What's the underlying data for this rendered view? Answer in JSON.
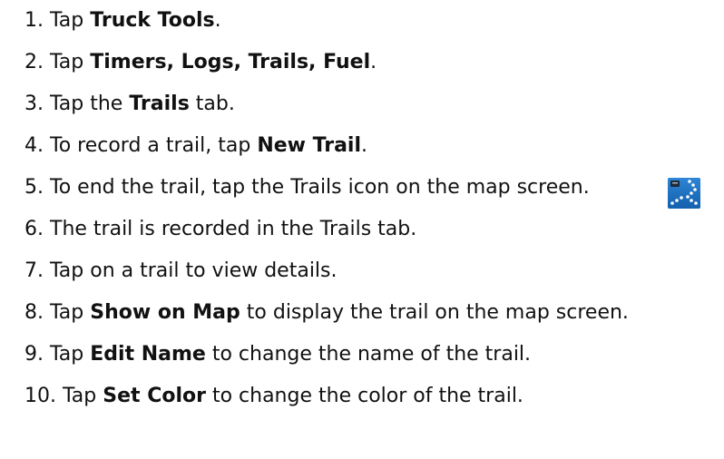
{
  "steps": [
    {
      "num": "1.",
      "parts": [
        {
          "t": "Tap ",
          "b": false
        },
        {
          "t": "Truck Tools",
          "b": true
        },
        {
          "t": ".",
          "b": false
        }
      ]
    },
    {
      "num": "2.",
      "parts": [
        {
          "t": "Tap ",
          "b": false
        },
        {
          "t": "Timers, Logs, Trails, Fuel",
          "b": true
        },
        {
          "t": ".",
          "b": false
        }
      ]
    },
    {
      "num": "3.",
      "parts": [
        {
          "t": "Tap the ",
          "b": false
        },
        {
          "t": "Trails",
          "b": true
        },
        {
          "t": " tab.",
          "b": false
        }
      ]
    },
    {
      "num": "4.",
      "parts": [
        {
          "t": "To record a trail, tap ",
          "b": false
        },
        {
          "t": "New Trail",
          "b": true
        },
        {
          "t": ".",
          "b": false
        }
      ]
    },
    {
      "num": "5.",
      "parts": [
        {
          "t": "To end the trail, tap the Trails icon on the map screen.",
          "b": false
        }
      ]
    },
    {
      "num": "6.",
      "parts": [
        {
          "t": "The trail is recorded in the Trails tab.",
          "b": false
        }
      ]
    },
    {
      "num": "7.",
      "parts": [
        {
          "t": "Tap on a trail to view details.",
          "b": false
        }
      ]
    },
    {
      "num": "8.",
      "parts": [
        {
          "t": "Tap ",
          "b": false
        },
        {
          "t": "Show on Map",
          "b": true
        },
        {
          "t": " to display the trail on the map screen.",
          "b": false
        }
      ]
    },
    {
      "num": "9.",
      "parts": [
        {
          "t": "Tap ",
          "b": false
        },
        {
          "t": "Edit Name",
          "b": true
        },
        {
          "t": " to change the name of the trail.",
          "b": false
        }
      ]
    },
    {
      "num": "10.",
      "parts": [
        {
          "t": "Tap ",
          "b": false
        },
        {
          "t": "Set Color",
          "b": true
        },
        {
          "t": " to change the color of the trail.",
          "b": false
        }
      ]
    }
  ],
  "icons": {
    "trails": "trails-icon"
  },
  "colors": {
    "text": "#111111",
    "icon_bg": "#1b74c8",
    "icon_dots": "#ffffff"
  }
}
